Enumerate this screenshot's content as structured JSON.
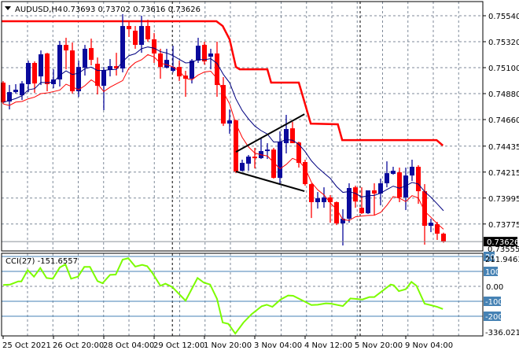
{
  "header": {
    "symbol": "AUDUSD,H4",
    "ohlc": "0.73693 0.73702 0.73616 0.73626"
  },
  "colors": {
    "bull": "#0a0a9c",
    "bear": "#ff0000",
    "ma_slow": "#000080",
    "ma_fast": "#ff0000",
    "resistance": "#ff0000",
    "cci": "#7cfc00",
    "level": "#4682b4",
    "grid": "#7f8a99",
    "current_price_bg": "#000000"
  },
  "chart_data": {
    "type": "candlestick",
    "title": "AUDUSD,H4",
    "ylim": [
      0.73546,
      0.7566
    ],
    "price_ticks": [
      "0.75540",
      "0.75320",
      "0.75100",
      "0.74880",
      "0.74660",
      "0.74435",
      "0.74215",
      "0.73995",
      "0.73775"
    ],
    "current_price": "0.73626",
    "lower_price_label": "0.73555",
    "time_labels": [
      "25 Oct 2021",
      "26 Oct 20:00",
      "28 Oct 04:00",
      "29 Oct 12:00",
      "1 Nov 20:00",
      "3 Nov 04:00",
      "4 Nov 12:00",
      "5 Nov 20:00",
      "9 Nov 04:00"
    ],
    "time_label_bars": [
      0,
      8,
      16,
      24,
      32,
      40,
      48,
      56,
      64
    ],
    "separator_bars": [
      26.9,
      56.75
    ],
    "candles": [
      [
        0.74973,
        0.74986,
        0.74793,
        0.74806
      ],
      [
        0.74813,
        0.74953,
        0.74746,
        0.74893
      ],
      [
        0.74893,
        0.7496,
        0.7488,
        0.74913
      ],
      [
        0.74866,
        0.74986,
        0.74826,
        0.74966
      ],
      [
        0.7496,
        0.7516,
        0.74893,
        0.7514
      ],
      [
        0.7514,
        0.75153,
        0.74886,
        0.74966
      ],
      [
        0.75026,
        0.75246,
        0.74953,
        0.75213
      ],
      [
        0.7522,
        0.75226,
        0.749,
        0.7496
      ],
      [
        0.7496,
        0.75086,
        0.74926,
        0.75
      ],
      [
        0.75,
        0.75326,
        0.7494,
        0.75293
      ],
      [
        0.75293,
        0.75353,
        0.75086,
        0.75246
      ],
      [
        0.75246,
        0.75313,
        0.7488,
        0.749
      ],
      [
        0.749,
        0.7516,
        0.74853,
        0.75106
      ],
      [
        0.751,
        0.75293,
        0.75033,
        0.7526
      ],
      [
        0.75266,
        0.75346,
        0.7512,
        0.75166
      ],
      [
        0.75133,
        0.75186,
        0.74873,
        0.74946
      ],
      [
        0.74946,
        0.75106,
        0.7474,
        0.7508
      ],
      [
        0.7508,
        0.75173,
        0.75026,
        0.75113
      ],
      [
        0.75113,
        0.75226,
        0.75033,
        0.75093
      ],
      [
        0.75093,
        0.75553,
        0.7506,
        0.75453
      ],
      [
        0.75453,
        0.75493,
        0.7536,
        0.75426
      ],
      [
        0.75413,
        0.75453,
        0.7526,
        0.75293
      ],
      [
        0.75293,
        0.7554,
        0.75226,
        0.75453
      ],
      [
        0.75453,
        0.75506,
        0.7532,
        0.7534
      ],
      [
        0.7534,
        0.75393,
        0.7514,
        0.7522
      ],
      [
        0.7522,
        0.7526,
        0.75006,
        0.75106
      ],
      [
        0.751,
        0.7526,
        0.75093,
        0.75166
      ],
      [
        0.75073,
        0.75286,
        0.7506,
        0.75106
      ],
      [
        0.75106,
        0.7516,
        0.74986,
        0.75026
      ],
      [
        0.75033,
        0.75073,
        0.74853,
        0.75006
      ],
      [
        0.75006,
        0.75173,
        0.74966,
        0.7516
      ],
      [
        0.7516,
        0.75353,
        0.7514,
        0.75286
      ],
      [
        0.75293,
        0.7532,
        0.75126,
        0.75153
      ],
      [
        0.75193,
        0.7526,
        0.75086,
        0.7522
      ],
      [
        0.7522,
        0.7532,
        0.74853,
        0.74953
      ],
      [
        0.74953,
        0.7502,
        0.74606,
        0.74626
      ],
      [
        0.74626,
        0.74746,
        0.7454,
        0.74653
      ],
      [
        0.74653,
        0.7466,
        0.74206,
        0.7422
      ],
      [
        0.74226,
        0.7432,
        0.7422,
        0.74293
      ],
      [
        0.74286,
        0.7436,
        0.74226,
        0.74346
      ],
      [
        0.74346,
        0.7442,
        0.74246,
        0.74333
      ],
      [
        0.74333,
        0.74506,
        0.74326,
        0.74393
      ],
      [
        0.74393,
        0.7446,
        0.74326,
        0.74406
      ],
      [
        0.74406,
        0.7442,
        0.7416,
        0.74166
      ],
      [
        0.74166,
        0.7456,
        0.74106,
        0.74473
      ],
      [
        0.7446,
        0.747,
        0.74373,
        0.7458
      ],
      [
        0.74586,
        0.7464,
        0.7446,
        0.7446
      ],
      [
        0.74466,
        0.74473,
        0.74253,
        0.74293
      ],
      [
        0.743,
        0.7432,
        0.741,
        0.74113
      ],
      [
        0.74113,
        0.7412,
        0.73826,
        0.7396
      ],
      [
        0.7396,
        0.74046,
        0.73906,
        0.73993
      ],
      [
        0.7396,
        0.74086,
        0.73913,
        0.74
      ],
      [
        0.74,
        0.7402,
        0.73786,
        0.7396
      ],
      [
        0.7396,
        0.73966,
        0.73766,
        0.7378
      ],
      [
        0.7378,
        0.739,
        0.73593,
        0.7382
      ],
      [
        0.7382,
        0.7412,
        0.73786,
        0.7408
      ],
      [
        0.74086,
        0.741,
        0.73913,
        0.73966
      ],
      [
        0.73913,
        0.74086,
        0.7386,
        0.73866
      ],
      [
        0.73866,
        0.7406,
        0.7386,
        0.7406
      ],
      [
        0.7406,
        0.7412,
        0.73853,
        0.74033
      ],
      [
        0.74033,
        0.7416,
        0.73933,
        0.7412
      ],
      [
        0.7412,
        0.74306,
        0.74086,
        0.74206
      ],
      [
        0.742,
        0.7426,
        0.74193,
        0.74226
      ],
      [
        0.74213,
        0.74253,
        0.7396,
        0.74
      ],
      [
        0.74,
        0.74253,
        0.73893,
        0.74186
      ],
      [
        0.74186,
        0.7432,
        0.7414,
        0.7426
      ],
      [
        0.7426,
        0.74273,
        0.73946,
        0.74053
      ],
      [
        0.74053,
        0.74113,
        0.736,
        0.7376
      ],
      [
        0.7376,
        0.7382,
        0.73706,
        0.73786
      ],
      [
        0.73773,
        0.73793,
        0.7364,
        0.73693
      ],
      [
        0.73693,
        0.73702,
        0.73616,
        0.73626
      ]
    ],
    "resistance_line": [
      [
        -0.25,
        0.75493
      ],
      [
        33.9,
        0.75493
      ],
      [
        34.9,
        0.75453
      ],
      [
        36,
        0.7534
      ],
      [
        37,
        0.75106
      ],
      [
        37.6,
        0.75086
      ],
      [
        42,
        0.75086
      ],
      [
        42.6,
        0.74973
      ],
      [
        47,
        0.74973
      ],
      [
        48.9,
        0.74626
      ],
      [
        53.2,
        0.7462
      ],
      [
        53.9,
        0.74486
      ],
      [
        68.9,
        0.74486
      ],
      [
        69.9,
        0.7444
      ]
    ],
    "trendlines": [
      {
        "name": "upper",
        "from": [
          37,
          0.74386
        ],
        "to": [
          47.9,
          0.74706
        ]
      },
      {
        "name": "lower",
        "from": [
          37,
          0.7422
        ],
        "to": [
          47.9,
          0.74053
        ]
      }
    ],
    "cci": {
      "label": "CCI(27) -151.6557",
      "period": 27,
      "value": -151.6557,
      "ylim": [
        -336.0213,
        211.9463
      ],
      "max_label": "211.9463",
      "min_label": "-336.0213",
      "levels": [
        200,
        100,
        -100,
        -200
      ],
      "level_labels": [
        "200",
        "100",
        "-100",
        "-200"
      ],
      "zero_label": "0.00",
      "points": [
        [
          0,
          9
        ],
        [
          1.1,
          12
        ],
        [
          2.4,
          33
        ],
        [
          2.9,
          33
        ],
        [
          3.9,
          109
        ],
        [
          4.9,
          65
        ],
        [
          5.9,
          123
        ],
        [
          6.9,
          56
        ],
        [
          7.9,
          51
        ],
        [
          9,
          126
        ],
        [
          9.9,
          147
        ],
        [
          10.8,
          51
        ],
        [
          11.9,
          65
        ],
        [
          12.9,
          130
        ],
        [
          13.8,
          130
        ],
        [
          15,
          35
        ],
        [
          15.8,
          21
        ],
        [
          17,
          77
        ],
        [
          17.9,
          79
        ],
        [
          19,
          179
        ],
        [
          19.9,
          188
        ],
        [
          21,
          132
        ],
        [
          22.1,
          144
        ],
        [
          22.9,
          135
        ],
        [
          23.7,
          91
        ],
        [
          25,
          4
        ],
        [
          25.8,
          18
        ],
        [
          26.9,
          -5
        ],
        [
          29,
          -96
        ],
        [
          30.9,
          56
        ],
        [
          31.9,
          25
        ],
        [
          32.9,
          12
        ],
        [
          34,
          -84
        ],
        [
          34.9,
          -242
        ],
        [
          35.8,
          -251
        ],
        [
          36.9,
          -316
        ],
        [
          38.2,
          -242
        ],
        [
          39.5,
          -186
        ],
        [
          41.1,
          -133
        ],
        [
          41.9,
          -123
        ],
        [
          42.8,
          -137
        ],
        [
          44.1,
          -88
        ],
        [
          45.3,
          -61
        ],
        [
          46.1,
          -63
        ],
        [
          47.1,
          -84
        ],
        [
          49,
          -125
        ],
        [
          50,
          -123
        ],
        [
          51.3,
          -114
        ],
        [
          52.1,
          -116
        ],
        [
          54,
          -132
        ],
        [
          55.2,
          -81
        ],
        [
          56.1,
          -84
        ],
        [
          57.1,
          -88
        ],
        [
          58.2,
          -72
        ],
        [
          59,
          -72
        ],
        [
          60,
          -40
        ],
        [
          61.6,
          12
        ],
        [
          62.1,
          7
        ],
        [
          62.9,
          -32
        ],
        [
          64,
          -19
        ],
        [
          64.9,
          30
        ],
        [
          65.7,
          4
        ],
        [
          67,
          -116
        ],
        [
          67.9,
          -125
        ],
        [
          69,
          -137
        ],
        [
          69.9,
          -151.6557
        ]
      ]
    }
  }
}
